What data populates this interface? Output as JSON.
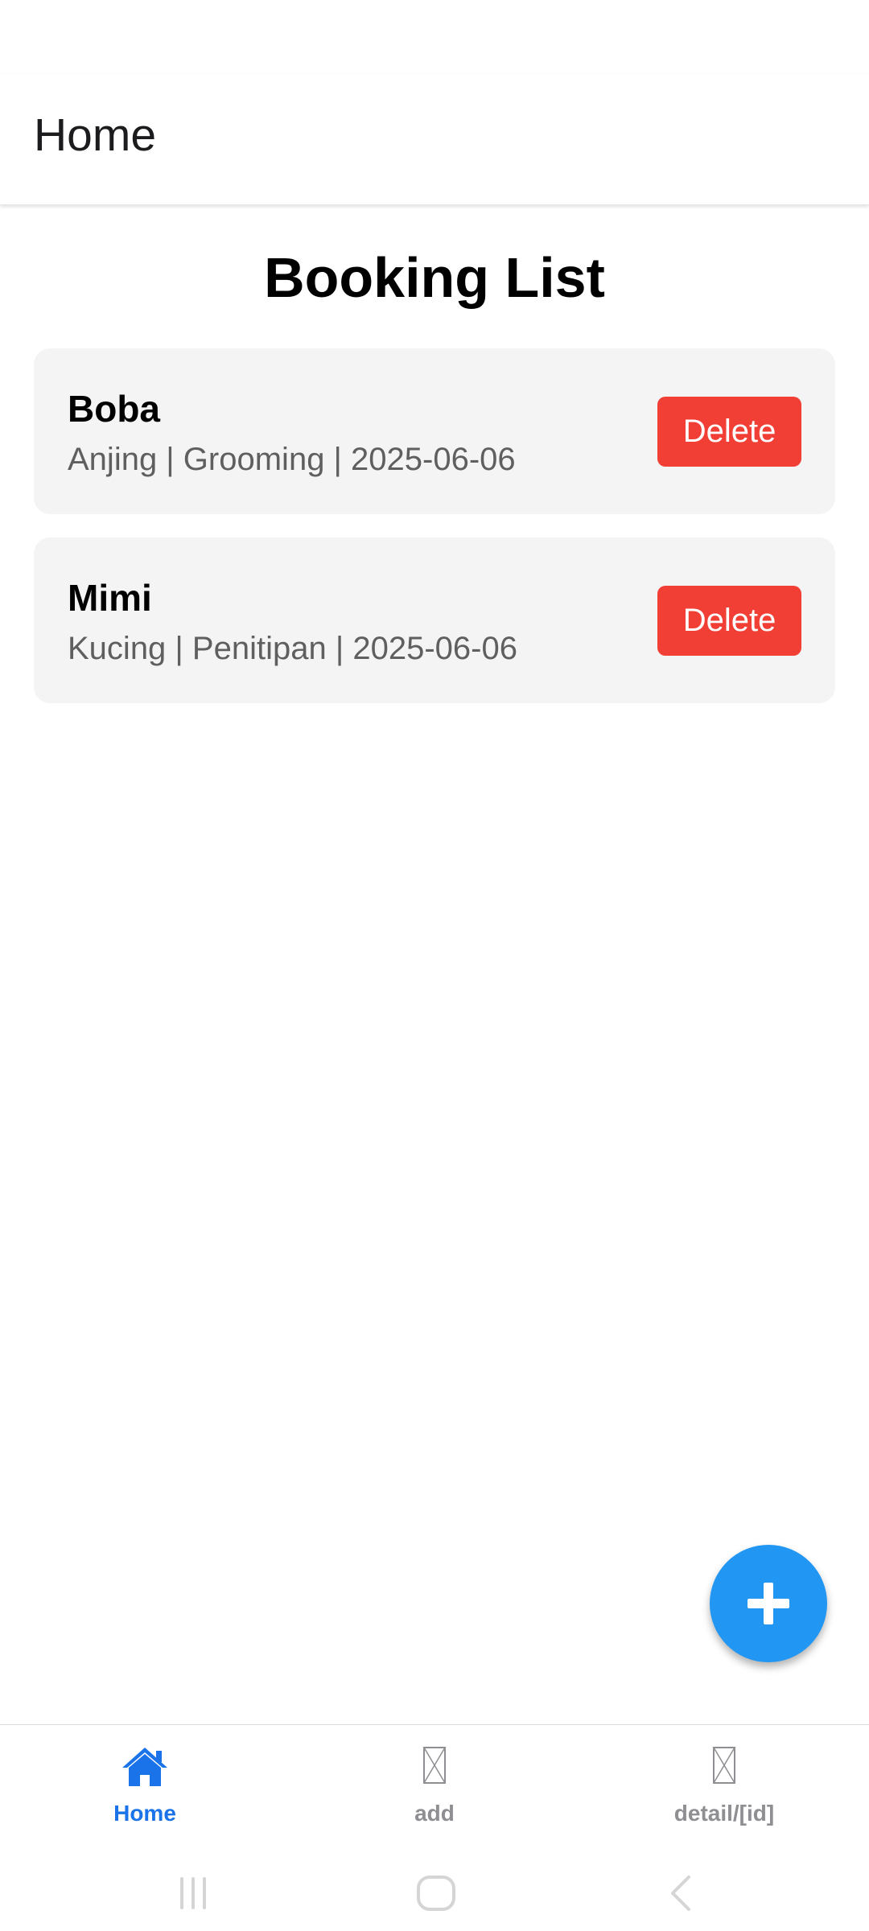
{
  "header": {
    "title": "Home"
  },
  "page": {
    "title": "Booking List"
  },
  "bookings": [
    {
      "name": "Boba",
      "details": "Anjing | Grooming | 2025-06-06",
      "delete_label": "Delete"
    },
    {
      "name": "Mimi",
      "details": "Kucing | Penitipan | 2025-06-06",
      "delete_label": "Delete"
    }
  ],
  "fab": {
    "icon": "plus-icon"
  },
  "tabs": [
    {
      "label": "Home",
      "icon": "home-icon",
      "active": true
    },
    {
      "label": "add",
      "icon": "missing-image-icon",
      "active": false
    },
    {
      "label": "detail/[id]",
      "icon": "missing-image-icon",
      "active": false
    }
  ],
  "system_nav": {
    "icons": [
      "recent-apps-icon",
      "home-button-icon",
      "back-icon"
    ]
  },
  "colors": {
    "accent": "#2196f3",
    "tab_active": "#1a73e8",
    "tab_inactive": "#8e8e93",
    "delete": "#f23f35",
    "card_bg": "#f4f4f4"
  }
}
